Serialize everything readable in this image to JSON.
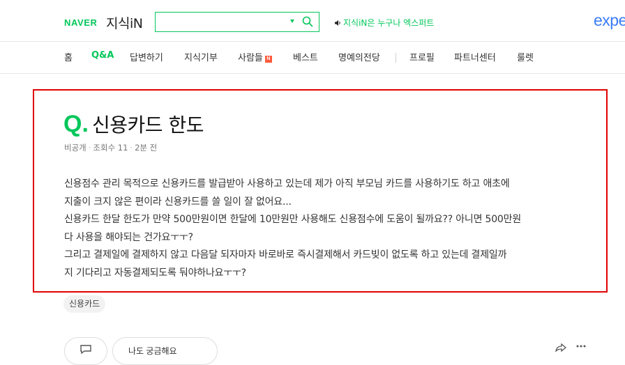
{
  "header": {
    "naver_logo": "NAVER",
    "service_name": "지식iN",
    "search": {
      "value": "",
      "placeholder": ""
    },
    "announcement": "지식iN은 누구나 엑스퍼트",
    "expert_logo": "expe"
  },
  "nav": {
    "items": [
      {
        "label": "홈"
      },
      {
        "label": "Q&A"
      },
      {
        "label": "답변하기"
      },
      {
        "label": "지식기부"
      },
      {
        "label": "사람들"
      },
      {
        "label": "베스트"
      },
      {
        "label": "명예의전당"
      },
      {
        "label": "프로필"
      },
      {
        "label": "파트너센터"
      },
      {
        "label": "룰렛"
      }
    ],
    "active": "Q&A",
    "new_badge": "N"
  },
  "question": {
    "q_mark": "Q.",
    "title": "신용카드 한도",
    "author": "비공개",
    "views": "조회수 11",
    "time": "2분 전",
    "body_lines": [
      "신용점수 관리 목적으로 신용카드를 발급받아 사용하고 있는데 제가 아직 부모님 카드를 사용하기도 하고 애초에",
      "지출이 크지 않은 편이라 신용카드를 쓸 일이 잘 없어요...",
      "신용카드 한달 한도가 만약 500만원이면 한달에 10만원만 사용해도 신용점수에 도움이 될까요?? 아니면 500만원",
      "다 사용을 해야되는 건가요ㅜㅜ?",
      "그리고 결제일에 결제하지 않고 다음달 되자마자 바로바로 즉시결제해서 카드빚이 없도록 하고 있는데 결제일까",
      "지 기다리고 자동결제되도록 둬야하나요ㅜㅜ?"
    ],
    "tag": "신용카드"
  },
  "actions": {
    "second_button_label": "나도 궁금해요"
  },
  "colors": {
    "brand_green": "#03c75a",
    "highlight_red": "#e00000",
    "expert_blue": "#3c7cf6"
  }
}
